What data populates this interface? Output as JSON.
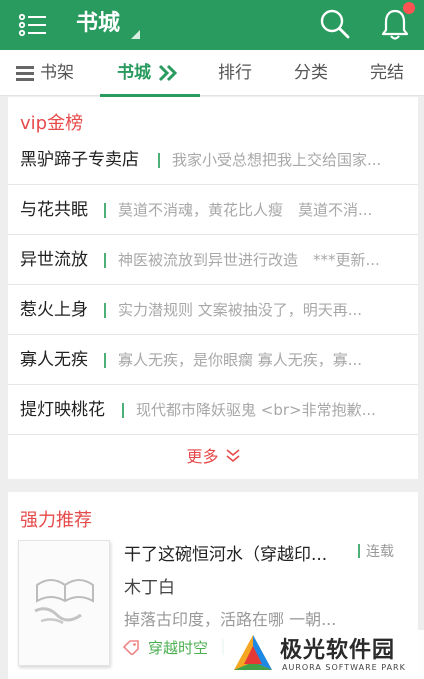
{
  "header": {
    "title": "书城",
    "icons": [
      "menu-icon",
      "search-icon",
      "bell-icon"
    ],
    "accent_color": "#2a9b5f",
    "notification_dot_color": "#ff5252"
  },
  "tabs": [
    {
      "label": "书架",
      "icon": "shelf-icon"
    },
    {
      "label": "书城",
      "icon": "double-chevron-right-icon",
      "active": true
    },
    {
      "label": "排行"
    },
    {
      "label": "分类"
    },
    {
      "label": "完结"
    }
  ],
  "vip": {
    "title": "vip金榜",
    "rows": [
      {
        "name": "黑驴蹄子专卖店",
        "desc": "我家小受总想把我上交给国家..."
      },
      {
        "name": "与花共眠",
        "desc": "莫道不消魂，黄花比人瘦　莫道不消..."
      },
      {
        "name": "异世流放",
        "desc": "神医被流放到异世进行改造　***更新..."
      },
      {
        "name": "惹火上身",
        "desc": "实力潜规则 文案被抽没了，明天再..."
      },
      {
        "name": "寡人无疾",
        "desc": "寡人无疾，是你眼瘸 寡人无疾，寡..."
      },
      {
        "name": "提灯映桃花",
        "desc": "现代都市降妖驱鬼 <br>非常抱歉..."
      }
    ],
    "more_label": "更多"
  },
  "recommend": {
    "title": "强力推荐",
    "book": {
      "title": "干了这碗恒河水（穿越印...",
      "status": "连载",
      "author": "木丁白",
      "synopsis": "掉落古印度，活路在哪 一朝...",
      "tag": "穿越时空"
    }
  },
  "watermark": {
    "text_cn": "极光软件园",
    "text_en": "AURORA SOFTWARE PARK"
  }
}
